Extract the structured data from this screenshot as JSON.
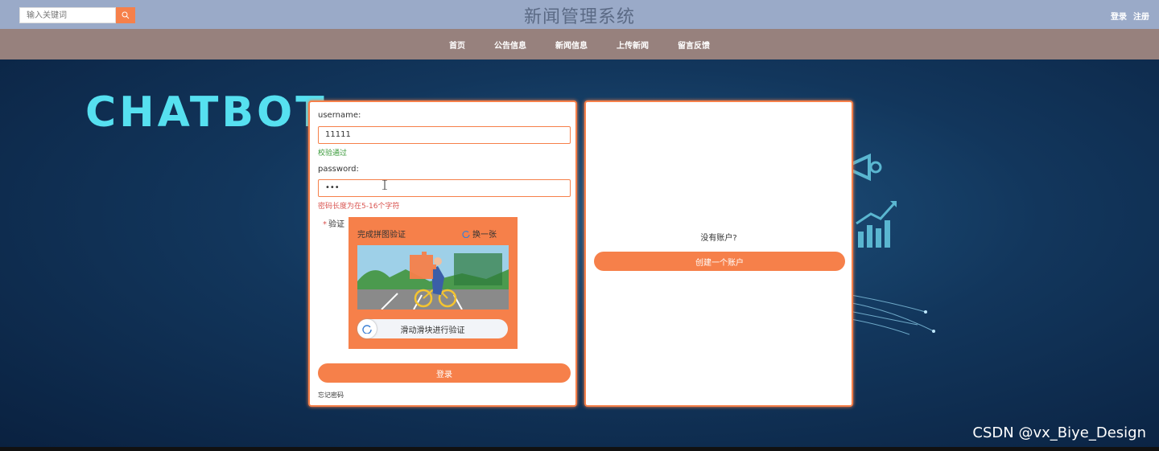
{
  "header": {
    "search_placeholder": "输入关键词",
    "site_title": "新闻管理系统",
    "login_link": "登录",
    "register_link": "注册"
  },
  "nav": {
    "items": [
      "首页",
      "公告信息",
      "新闻信息",
      "上传新闻",
      "留言反馈"
    ]
  },
  "banner": {
    "text": "CHATBOT"
  },
  "login_form": {
    "username_label": "username:",
    "username_value": "11111",
    "username_hint": "校验通过",
    "password_label": "password:",
    "password_value": "•••",
    "password_hint": "密码长度为在5-16个字符",
    "verify_label": "验证",
    "captcha_title": "完成拼图验证",
    "captcha_refresh": "换一张",
    "slider_text": "滑动滑块进行验证",
    "login_button": "登录",
    "forgot_password": "忘记密码"
  },
  "register_panel": {
    "no_account_text": "没有账户?",
    "create_button": "创建一个账户"
  },
  "watermark": "CSDN @vx_Biye_Design",
  "colors": {
    "accent": "#f6804a",
    "topbar": "#9aaac8",
    "navbar": "#97817d",
    "success": "#3a9a3a",
    "error": "#d9534f"
  }
}
